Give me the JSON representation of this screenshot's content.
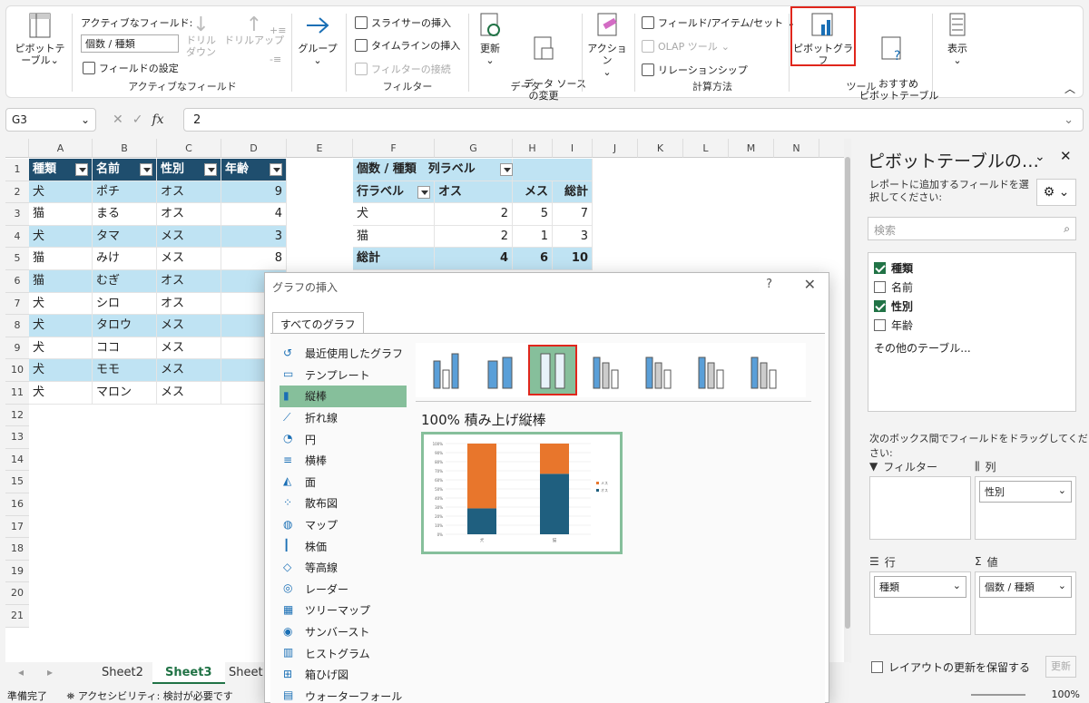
{
  "ribbon": {
    "pivot_button": "ピボットテーブル",
    "active_field_label": "アクティブなフィールド:",
    "active_field_value": "個数 / 種類",
    "field_settings": "フィールドの設定",
    "drilldown": "ドリル\nダウン",
    "drillup": "ドリルアップ",
    "group_active_field": "アクティブなフィールド",
    "group_button": "グループ",
    "insert_slicer": "スライサーの挿入",
    "insert_timeline": "タイムラインの挿入",
    "filter_connections": "フィルターの接続",
    "group_filter": "フィルター",
    "refresh": "更新",
    "change_data_source": "データ ソース\nの変更",
    "group_data": "データ",
    "actions": "アクション",
    "fields_items_sets": "フィールド/アイテム/セット",
    "olap_tools": "OLAP ツール",
    "relationships": "リレーションシップ",
    "group_calc": "計算方法",
    "pivotchart": "ピボットグラフ",
    "recommended_pivot": "おすすめ\nピボットテーブル",
    "group_tools": "ツール",
    "show": "表示"
  },
  "formula": {
    "namebox": "G3",
    "value": "2"
  },
  "columns": [
    "A",
    "B",
    "C",
    "D",
    "E",
    "F",
    "G",
    "H",
    "I",
    "J",
    "K",
    "L",
    "M",
    "N"
  ],
  "rows": [
    "1",
    "2",
    "3",
    "4",
    "5",
    "6",
    "7",
    "8",
    "9",
    "10",
    "11",
    "12",
    "13",
    "14",
    "15",
    "16",
    "17",
    "18",
    "19",
    "20",
    "21"
  ],
  "table": {
    "headers": [
      "種類",
      "名前",
      "性別",
      "年齢"
    ],
    "data": [
      [
        "犬",
        "ポチ",
        "オス",
        "9"
      ],
      [
        "猫",
        "まる",
        "オス",
        "4"
      ],
      [
        "犬",
        "タマ",
        "メス",
        "3"
      ],
      [
        "猫",
        "みけ",
        "メス",
        "8"
      ],
      [
        "猫",
        "むぎ",
        "オス",
        ""
      ],
      [
        "犬",
        "シロ",
        "オス",
        ""
      ],
      [
        "犬",
        "タロウ",
        "メス",
        ""
      ],
      [
        "犬",
        "ココ",
        "メス",
        ""
      ],
      [
        "犬",
        "モモ",
        "メス",
        ""
      ],
      [
        "犬",
        "マロン",
        "メス",
        ""
      ]
    ]
  },
  "pivot": {
    "corner": "個数 / 種類",
    "col_labels": "列ラベル",
    "row_labels": "行ラベル",
    "col1": "オス",
    "col2": "メス",
    "total": "総計",
    "rows": [
      [
        "犬",
        "2",
        "5",
        "7"
      ],
      [
        "猫",
        "2",
        "1",
        "3"
      ]
    ],
    "grand": [
      "総計",
      "4",
      "6",
      "10"
    ]
  },
  "sheets": [
    "Sheet2",
    "Sheet3",
    "Sheet"
  ],
  "status": {
    "ready": "準備完了",
    "accessibility": "アクセシビリティ: 検討が必要です",
    "zoom": "100%"
  },
  "dialog": {
    "title": "グラフの挿入",
    "help": "?",
    "close": "✕",
    "tab": "すべてのグラフ",
    "types": [
      "最近使用したグラフ",
      "テンプレート",
      "縦棒",
      "折れ線",
      "円",
      "横棒",
      "面",
      "散布図",
      "マップ",
      "株価",
      "等高線",
      "レーダー",
      "ツリーマップ",
      "サンバースト",
      "ヒストグラム",
      "箱ひげ図",
      "ウォーターフォール"
    ],
    "selected_type": "縦棒",
    "subtype_title": "100% 積み上げ縦棒"
  },
  "chart_data": {
    "type": "bar",
    "stacked": "100%",
    "categories": [
      "犬",
      "猫"
    ],
    "series": [
      {
        "name": "オス",
        "values": [
          2,
          2
        ],
        "color": "#1f5f7f"
      },
      {
        "name": "メス",
        "values": [
          5,
          1
        ],
        "color": "#e8762c"
      }
    ],
    "ylim": [
      0,
      100
    ],
    "yticks": [
      "0%",
      "10%",
      "20%",
      "30%",
      "40%",
      "50%",
      "60%",
      "70%",
      "80%",
      "90%",
      "100%"
    ]
  },
  "pane": {
    "title": "ピボットテーブルの…",
    "instruction": "レポートに追加するフィールドを選択してください:",
    "search_placeholder": "検索",
    "fields": [
      {
        "label": "種類",
        "checked": true
      },
      {
        "label": "名前",
        "checked": false
      },
      {
        "label": "性別",
        "checked": true
      },
      {
        "label": "年齢",
        "checked": false
      }
    ],
    "more_tables": "その他のテーブル...",
    "drag_instruction": "次のボックス間でフィールドをドラッグしてください:",
    "filter_label": "フィルター",
    "columns_label": "列",
    "rows_label": "行",
    "values_label": "値",
    "column_field": "性別",
    "row_field": "種類",
    "value_field": "個数 / 種類",
    "defer": "レイアウトの更新を保留する",
    "update": "更新"
  }
}
